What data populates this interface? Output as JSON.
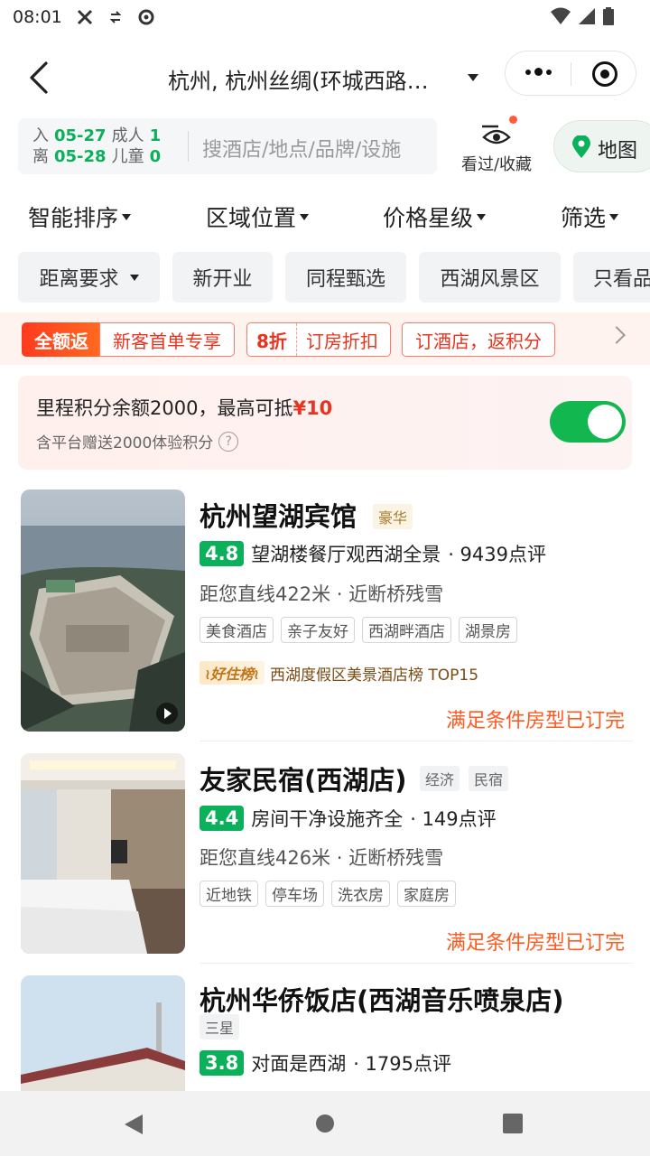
{
  "status_bar": {
    "time": "08:01"
  },
  "header": {
    "title": "杭州, 杭州丝绸(环城西路…"
  },
  "search": {
    "checkin_label": "入",
    "checkin_date": "05-27",
    "checkout_label": "离",
    "checkout_date": "05-28",
    "adults_label": "成人",
    "adults": "1",
    "children_label": "儿童",
    "children": "0",
    "placeholder": "搜酒店/地点/品牌/设施",
    "favorites_label": "看过/收藏",
    "map_label": "地图"
  },
  "sort_bar": [
    {
      "label": "智能排序"
    },
    {
      "label": "区域位置"
    },
    {
      "label": "价格星级"
    },
    {
      "label": "筛选"
    }
  ],
  "quick_filters": [
    {
      "label": "距离要求"
    },
    {
      "label": "新开业"
    },
    {
      "label": "同程甄选"
    },
    {
      "label": "西湖风景区"
    },
    {
      "label": "只看品"
    }
  ],
  "promo": {
    "badge": "全额返",
    "item1": "新客首单专享",
    "item2_strong": "8折",
    "item2": "订房折扣",
    "item3": "订酒店，返积分"
  },
  "points": {
    "text": "里程积分余额2000，最高可抵",
    "amount": "¥10",
    "subtext": "含平台赠送2000体验积分",
    "help": "?",
    "toggle_on": true
  },
  "hotels": [
    {
      "name": "杭州望湖宾馆",
      "level": "豪华",
      "score": "4.8",
      "review_summary": "望湖楼餐厅观西湖全景",
      "review_count": "· 9439点评",
      "distance": "距您直线422米 · 近断桥残雪",
      "tags": [
        "美食酒店",
        "亲子友好",
        "西湖畔酒店",
        "湖景房"
      ],
      "rank_badge": "≀好住榜≀",
      "rank_text": "西湖度假区美景酒店榜 TOP15",
      "status": "满足条件房型已订完"
    },
    {
      "name": "友家民宿(西湖店)",
      "levels": [
        "经济",
        "民宿"
      ],
      "score": "4.4",
      "review_summary": "房间干净设施齐全",
      "review_count": "· 149点评",
      "distance": "距您直线426米 · 近断桥残雪",
      "tags": [
        "近地铁",
        "停车场",
        "洗衣房",
        "家庭房"
      ],
      "status": "满足条件房型已订完"
    },
    {
      "name": "杭州华侨饭店(西湖音乐喷泉店)",
      "level": "三星",
      "score": "3.8",
      "review_summary": "对面是西湖",
      "review_count": "· 1795点评"
    }
  ],
  "colors": {
    "accent_green": "#0bb05a",
    "promo_red": "#e8341f",
    "soldout_orange": "#ff5a1f"
  }
}
